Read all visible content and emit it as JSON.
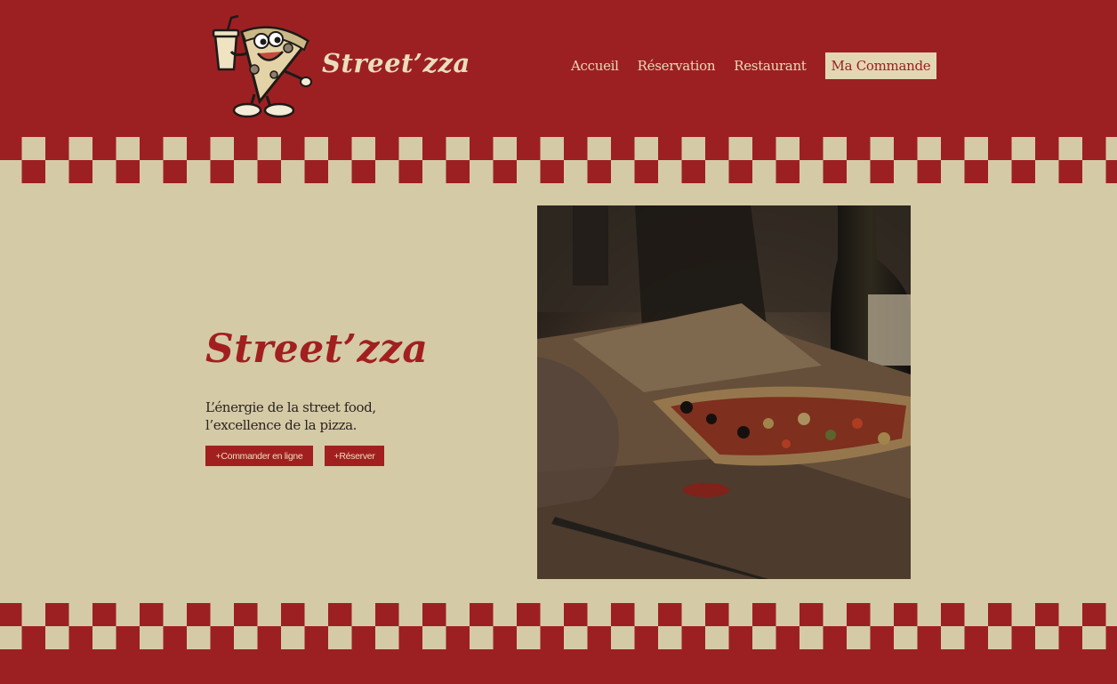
{
  "header": {
    "brand": "Street’zza",
    "logo_icon": "pizza-mascot-icon",
    "bg_color": "#9c2022",
    "text_color": "#e9ddbd"
  },
  "nav": {
    "items": [
      "Accueil",
      "Réservation",
      "Restaurant"
    ],
    "active_item": "Ma Commande"
  },
  "hero": {
    "title": "Street’zza",
    "tagline_line1": "L’énergie de la street food,",
    "tagline_line2": "l’excellence de la pizza.",
    "order_button": "+Commander en ligne",
    "book_button": "+Réserver",
    "photo_icon": "pizza-photo-image",
    "accent_color": "#a1201f",
    "bg_color": "#d5caa6"
  }
}
